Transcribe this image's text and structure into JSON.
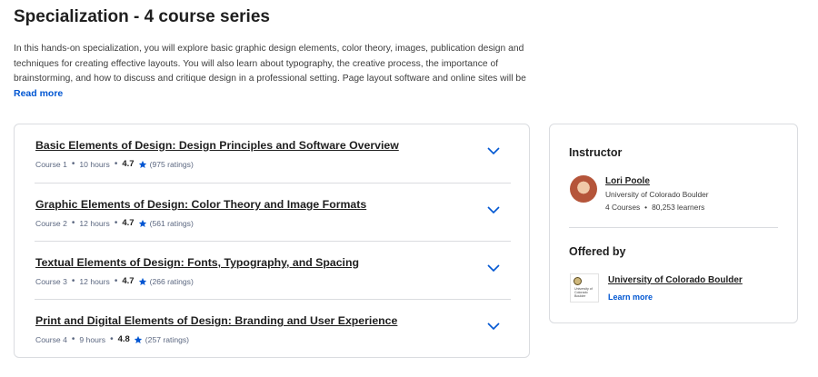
{
  "header": {
    "title": "Specialization - 4 course series",
    "description": "In this hands-on specialization, you will explore basic graphic design elements, color theory, images, publication design and techniques for creating effective layouts. You will also learn about typography, the creative process, the importance of brainstorming, and how to discuss and critique design in a professional setting. Page layout software and online sites will be used to incorporate and",
    "read_more": "Read more"
  },
  "courses": [
    {
      "title": "Basic Elements of Design: Design Principles and Software Overview",
      "course_no": "Course 1",
      "duration": "10 hours",
      "rating": "4.7",
      "ratings_count": "(975 ratings)"
    },
    {
      "title": "Graphic Elements of Design: Color Theory and Image Formats",
      "course_no": "Course 2",
      "duration": "12 hours",
      "rating": "4.7",
      "ratings_count": "(561 ratings)"
    },
    {
      "title": "Textual Elements of Design: Fonts, Typography, and Spacing",
      "course_no": "Course 3",
      "duration": "12 hours",
      "rating": "4.7",
      "ratings_count": "(266 ratings)"
    },
    {
      "title": "Print and Digital Elements of Design: Branding and User Experience",
      "course_no": "Course 4",
      "duration": "9 hours",
      "rating": "4.8",
      "ratings_count": "(257 ratings)"
    }
  ],
  "instructor": {
    "heading": "Instructor",
    "name": "Lori Poole",
    "org": "University of Colorado Boulder",
    "courses": "4 Courses",
    "learners": "80,253 learners"
  },
  "offered_by": {
    "heading": "Offered by",
    "name": "University of Colorado Boulder",
    "logo_text": "University of Colorado Boulder",
    "learn_more": "Learn more"
  },
  "colors": {
    "accent": "#0056d2",
    "text": "#1f1f1f",
    "muted": "#5b6780",
    "border": "#dadce0"
  },
  "icons": {
    "chevron": "chevron-down-icon",
    "star": "star-icon"
  }
}
